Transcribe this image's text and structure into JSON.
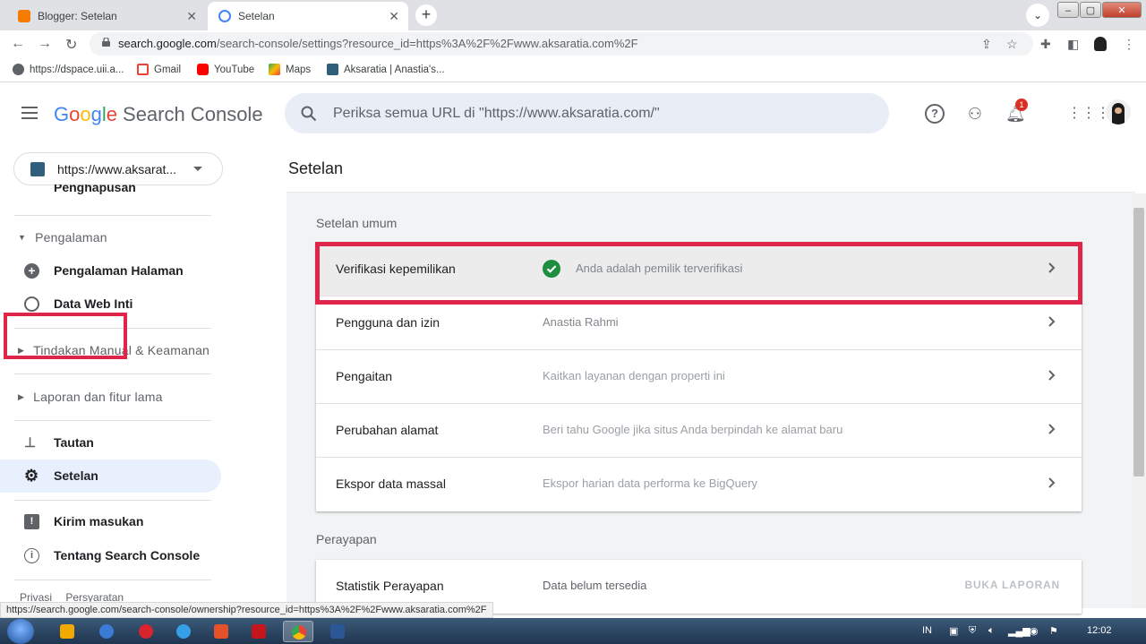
{
  "browser": {
    "tabs": [
      {
        "title": "Blogger: Setelan"
      },
      {
        "title": "Setelan"
      }
    ],
    "url_host": "search.google.com",
    "url_path": "/search-console/settings?resource_id=https%3A%2F%2Fwww.aksaratia.com%2F",
    "bookmarks": [
      {
        "label": "https://dspace.uii.a..."
      },
      {
        "label": "Gmail"
      },
      {
        "label": "YouTube"
      },
      {
        "label": "Maps"
      },
      {
        "label": "Aksaratia | Anastia's..."
      }
    ]
  },
  "header": {
    "logo_google": [
      "G",
      "o",
      "o",
      "g",
      "l",
      "e"
    ],
    "logo_product": "Search Console",
    "search_placeholder": "Periksa semua URL di \"https://www.aksaratia.com/\"",
    "notification_count": "1"
  },
  "sidebar": {
    "property": "https://www.aksarat...",
    "partial_item": "Penghapusan",
    "sections": {
      "pengalaman": "Pengalaman",
      "tindakan": "Tindakan Manual & Keamanan",
      "laporan": "Laporan dan fitur lama"
    },
    "items": {
      "pengalaman_halaman": "Pengalaman Halaman",
      "data_web_inti": "Data Web Inti",
      "tautan": "Tautan",
      "setelan": "Setelan",
      "kirim_masukan": "Kirim masukan",
      "tentang": "Tentang Search Console"
    },
    "footer_links": [
      "Privasi",
      "Persyaratan"
    ]
  },
  "main": {
    "title": "Setelan",
    "general_label": "Setelan umum",
    "general_rows": [
      {
        "label": "Verifikasi kepemilikan",
        "value": "Anda adalah pemilik terverifikasi"
      },
      {
        "label": "Pengguna dan izin",
        "value": "Anastia Rahmi"
      },
      {
        "label": "Pengaitan",
        "value": "Kaitkan layanan dengan properti ini"
      },
      {
        "label": "Perubahan alamat",
        "value": "Beri tahu Google jika situs Anda berpindah ke alamat baru"
      },
      {
        "label": "Ekspor data massal",
        "value": "Ekspor harian data performa ke BigQuery"
      }
    ],
    "crawl_label": "Perayapan",
    "crawl_row": {
      "label": "Statistik Perayapan",
      "value": "Data belum tersedia",
      "action": "BUKA LAPORAN"
    }
  },
  "status_url": "https://search.google.com/search-console/ownership?resource_id=https%3A%2F%2Fwww.aksaratia.com%2F",
  "taskbar": {
    "language": "IN",
    "clock": "12:02"
  },
  "colors": {
    "accent_red_box": "#e0254a",
    "selected_bg": "#e8f0fe",
    "verified_green": "#1e8e3e"
  }
}
